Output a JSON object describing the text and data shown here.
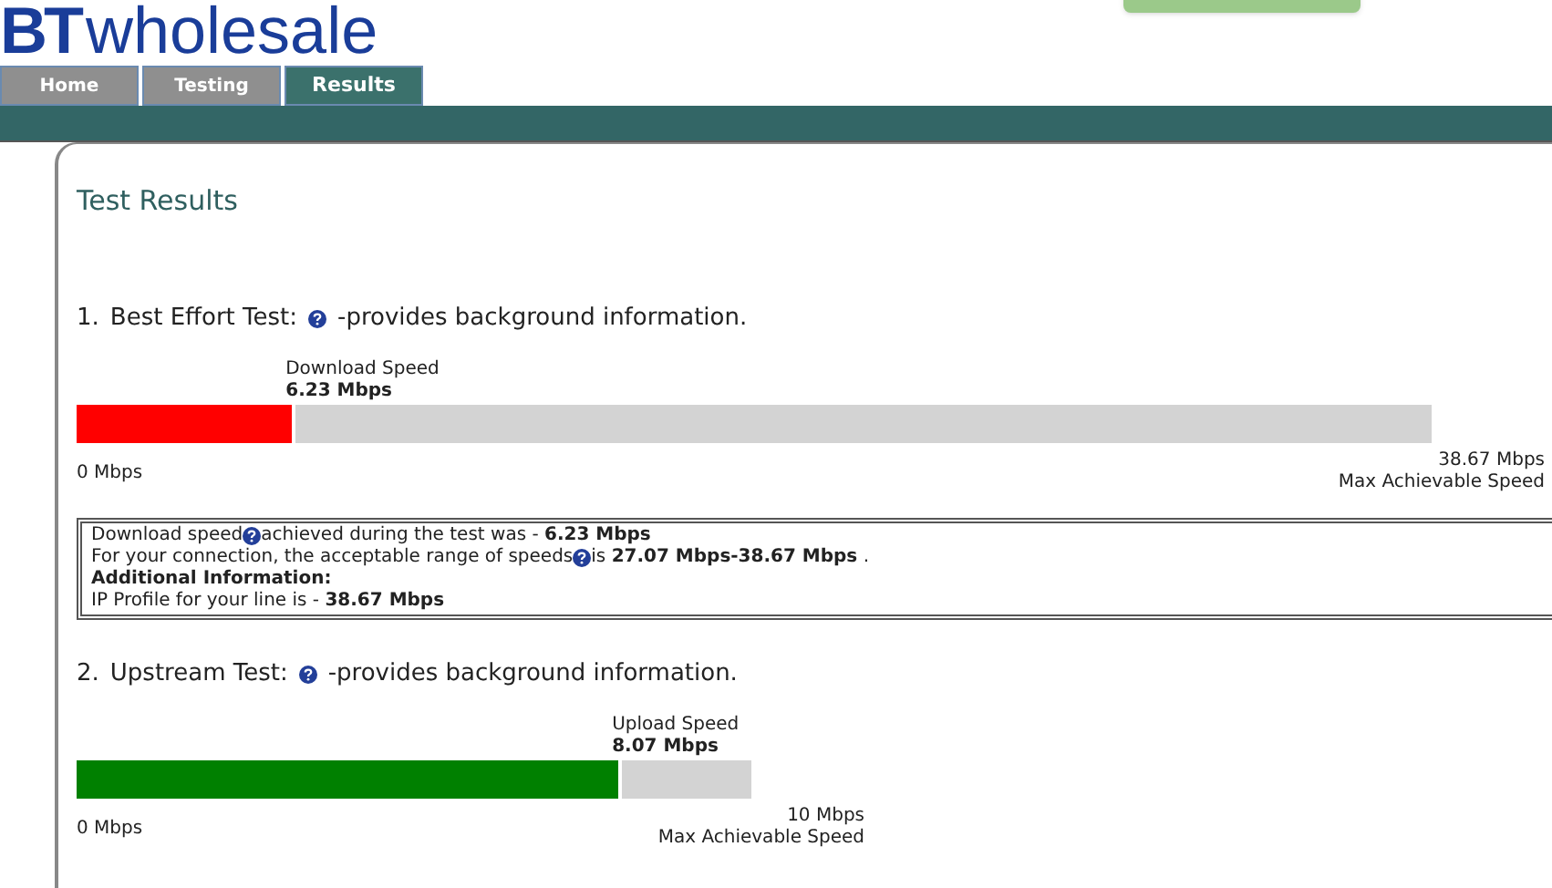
{
  "logo": {
    "brand": "BT",
    "name": "wholesale"
  },
  "tabs": [
    {
      "label": "Home",
      "selected": false
    },
    {
      "label": "Testing",
      "selected": false
    },
    {
      "label": "Results",
      "selected": true
    }
  ],
  "page_title": "Test Results",
  "tests": [
    {
      "number": "1.",
      "title": "Best Effort Test:",
      "info": "-provides background information.",
      "speed_label": "Download Speed",
      "speed": "6.23 Mbps",
      "level": 0.161,
      "color": "#ff0000",
      "wide": true,
      "min": "0 Mbps",
      "max": "38.67 Mbps",
      "max_label": "Max Achievable Speed",
      "details": [
        {
          "before": "Download speed",
          "help": true,
          "after": "achieved during the test was - **6.23 Mbps**"
        },
        {
          "before": "For your connection, the acceptable range of speeds",
          "help": true,
          "after": "is **27.07 Mbps-38.67 Mbps** ."
        },
        {
          "before": "**Additional Information:**",
          "help": false
        },
        {
          "before": "IP Profile for your line is - **38.67 Mbps**",
          "help": false
        }
      ]
    },
    {
      "number": "2.",
      "title": "Upstream Test:",
      "info": "-provides background information.",
      "speed_label": "Upload Speed",
      "speed": "8.07 Mbps",
      "level": 0.807,
      "color": "#008000",
      "wide": false,
      "min": "0 Mbps",
      "max": "10 Mbps",
      "max_label": "Max Achievable Speed"
    }
  ]
}
